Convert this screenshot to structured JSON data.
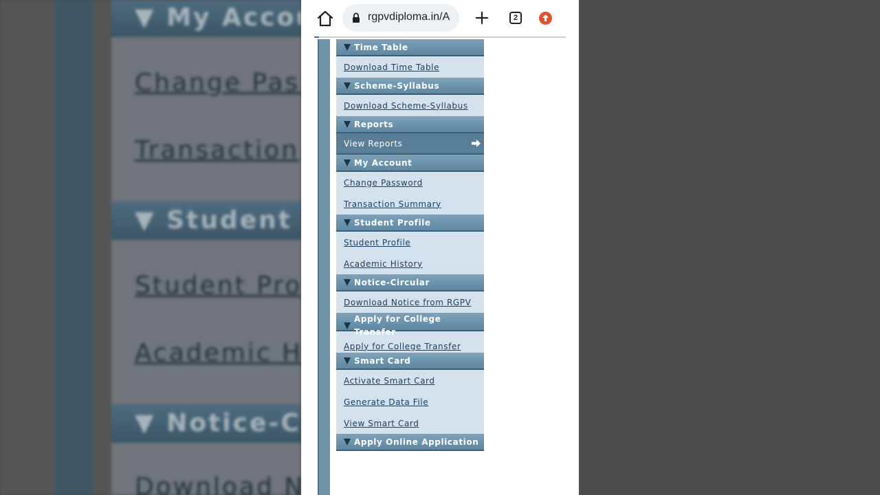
{
  "browser": {
    "url": "rgpvdiploma.in/A",
    "tab_count": "2",
    "load_progress": 0.02
  },
  "menu": {
    "time_table": {
      "header": "Time Table",
      "items": [
        "Download Time Table"
      ]
    },
    "scheme_syllabus": {
      "header": "Scheme-Syllabus",
      "items": [
        "Download Scheme-Syllabus"
      ]
    },
    "reports": {
      "header": "Reports",
      "items": [
        "View Reports"
      ]
    },
    "my_account": {
      "header": "My Account",
      "items": [
        "Change Password",
        "Transaction Summary"
      ]
    },
    "student_profile": {
      "header": "Student Profile",
      "items": [
        "Student Profile",
        "Academic History"
      ]
    },
    "notice_circular": {
      "header": "Notice-Circular",
      "items": [
        "Download Notice from RGPV"
      ]
    },
    "college_transfer": {
      "header": "Apply for College Transfer",
      "items": [
        "Apply for College Transfer"
      ]
    },
    "smart_card": {
      "header": "Smart Card",
      "items": [
        "Activate Smart Card",
        "Generate Data File",
        "View Smart Card"
      ]
    },
    "online_application": {
      "header": "Apply Online Application"
    }
  },
  "background": {
    "headers": [
      "My Accou",
      "Student P",
      "Notice-Ci"
    ],
    "links": [
      "Change Pass",
      "Transaction",
      "Student Prof",
      "Academic Hi",
      "Download N"
    ]
  },
  "colors": {
    "header_bg": "#6f95ab",
    "item_bg": "#d4e2ee",
    "active_item_bg": "#587f97",
    "link_color": "#1b3e5c"
  }
}
